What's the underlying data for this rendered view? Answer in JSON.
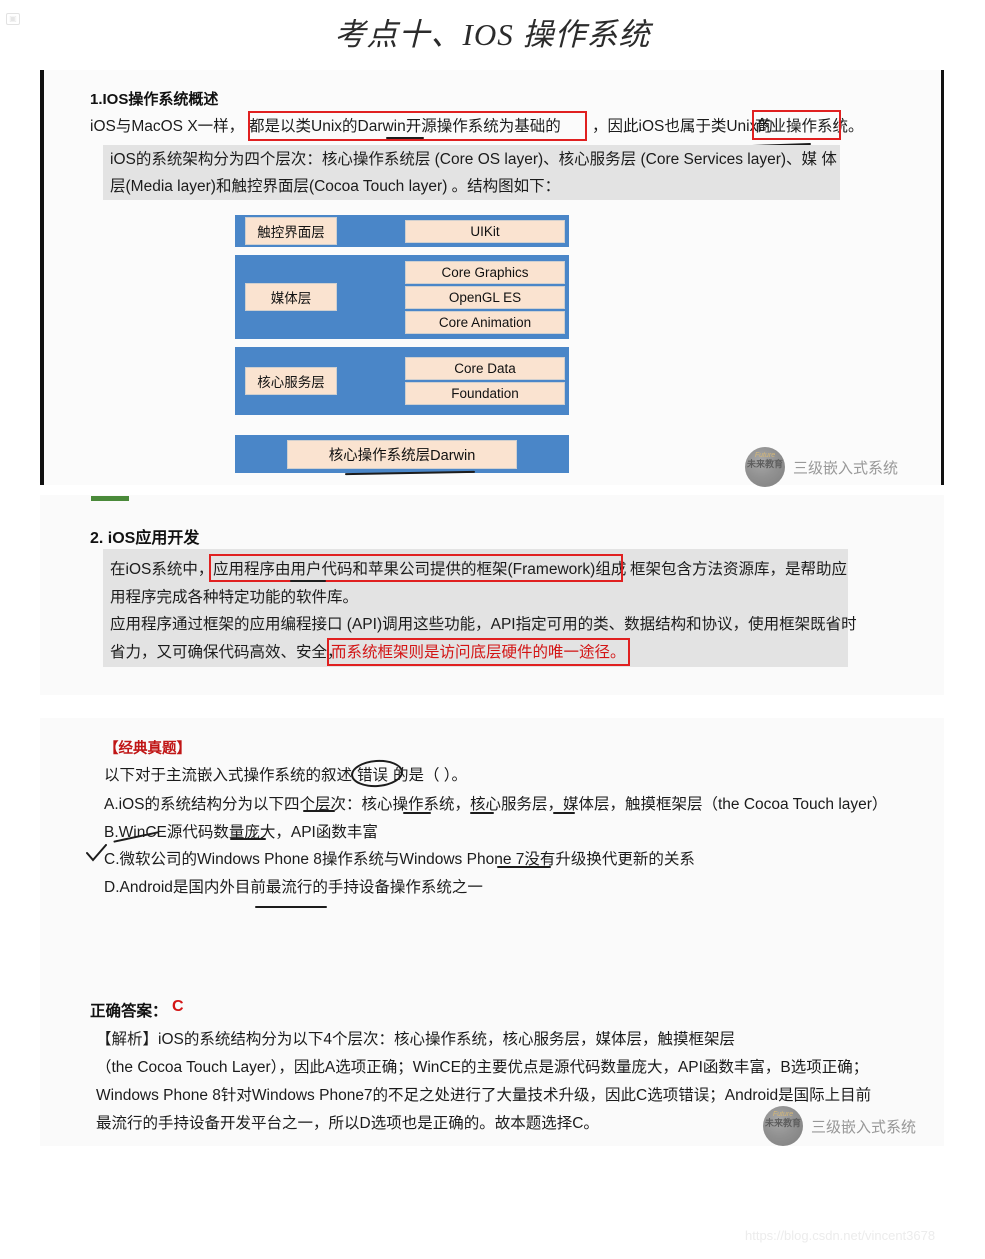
{
  "page": {
    "title": "考点十、IOS 操作系统",
    "footer_url": "https://blog.csdn.net/vincent3678",
    "broken_image_glyph": "▣"
  },
  "colors": {
    "accent_red": "#e02020",
    "answer_red": "#d31414",
    "diagram_blue": "#4a86c8",
    "diagram_peach": "#fae3d0",
    "green_bar": "#4a8a3a",
    "grey_block": "#e3e3e3"
  },
  "section_overview": {
    "heading": "1.IOS操作系统概述",
    "intro_line": "iOS与MacOS X一样，都是以类Unix的Darwin开源操作系统为基础的，因此iOS也属于类Unix的商业操作系统。",
    "intro_parts": {
      "prefix": "iOS与MacOS X一样，",
      "boxed_1": "都是以类Unix的Darwin开源操作系统为基础的",
      "middle": "，因此iOS也属于类Unix的",
      "boxed_2": "商业操作系统。"
    },
    "grey_paragraph": [
      "iOS的系统架构分为四个层次：核心操作系统层 (Core OS layer)、核心服务层 (Core Services layer)、媒 体",
      "层(Media layer)和触控界面层(Cocoa Touch layer) 。结构图如下："
    ]
  },
  "architecture": {
    "rows": [
      {
        "name": "touch-layer",
        "left_label": "触控界面层",
        "right_labels": [
          "UIKit"
        ]
      },
      {
        "name": "media-layer",
        "left_label": "媒体层",
        "right_labels": [
          "Core Graphics",
          "OpenGL ES",
          "Core Animation"
        ]
      },
      {
        "name": "core-services-layer",
        "left_label": "核心服务层",
        "right_labels": [
          "Core Data",
          "Foundation"
        ]
      }
    ],
    "bottom_row": {
      "name": "core-os-layer",
      "label": "核心操作系统层Darwin"
    }
  },
  "watermark": {
    "logo_title": "未来教育",
    "logo_sub": "Future",
    "text": "三级嵌入式系统"
  },
  "section_appdev": {
    "heading": "2. iOS应用开发",
    "lines": [
      {
        "prefix": "在iOS系统中，",
        "boxed": "应用程序由用户代码和苹果公司提供的框架(Framework)组成",
        "suffix": " 框架包含方法资源库，是帮助应"
      },
      {
        "text": "用程序完成各种特定功能的软件库。"
      },
      {
        "text": "应用程序通过框架的应用编程接口 (API)调用这些功能，API指定可用的类、数据结构和协议，使用框架既省时"
      },
      {
        "prefix": "省力，又可确保代码高效、安全，",
        "boxed_red_text": "而系统框架则是访问底层硬件的唯一途径。"
      }
    ]
  },
  "section_question": {
    "tag": "【经典真题】",
    "stem": "以下对于主流嵌入式操作系统的叙述 错误的是（ ）。",
    "stem_parts": {
      "before": "以下对于主流嵌入式操作系统的叙述",
      "circled": "错误",
      "after": "的是（ ）。"
    },
    "options": [
      "A.iOS的系统结构分为以下四个层次：核心操作系统，核心服务层，媒体层，触摸框架层（the Cocoa Touch layer）",
      "B.WinCE源代码数量庞大，API函数丰富",
      "C.微软公司的Windows Phone 8操作系统与Windows Phone 7没有升级换代更新的关系",
      "D.Android是国内外目前最流行的手持设备操作系统之一"
    ]
  },
  "section_answer": {
    "label": "正确答案：",
    "value": "C",
    "explanation_lines": [
      "【解析】iOS的系统结构分为以下4个层次：核心操作系统，核心服务层，媒体层，触摸框架层",
      "（the Cocoa Touch Layer），因此A选项正确；WinCE的主要优点是源代码数量庞大，API函数丰富，B选项正确；",
      "Windows Phone 8针对Windows Phone7的不足之处进行了大量技术升级，因此C选项错误；Android是国际上目前",
      "最流行的手持设备开发平台之一，所以D选项也是正确的。故本题选择C。"
    ]
  }
}
